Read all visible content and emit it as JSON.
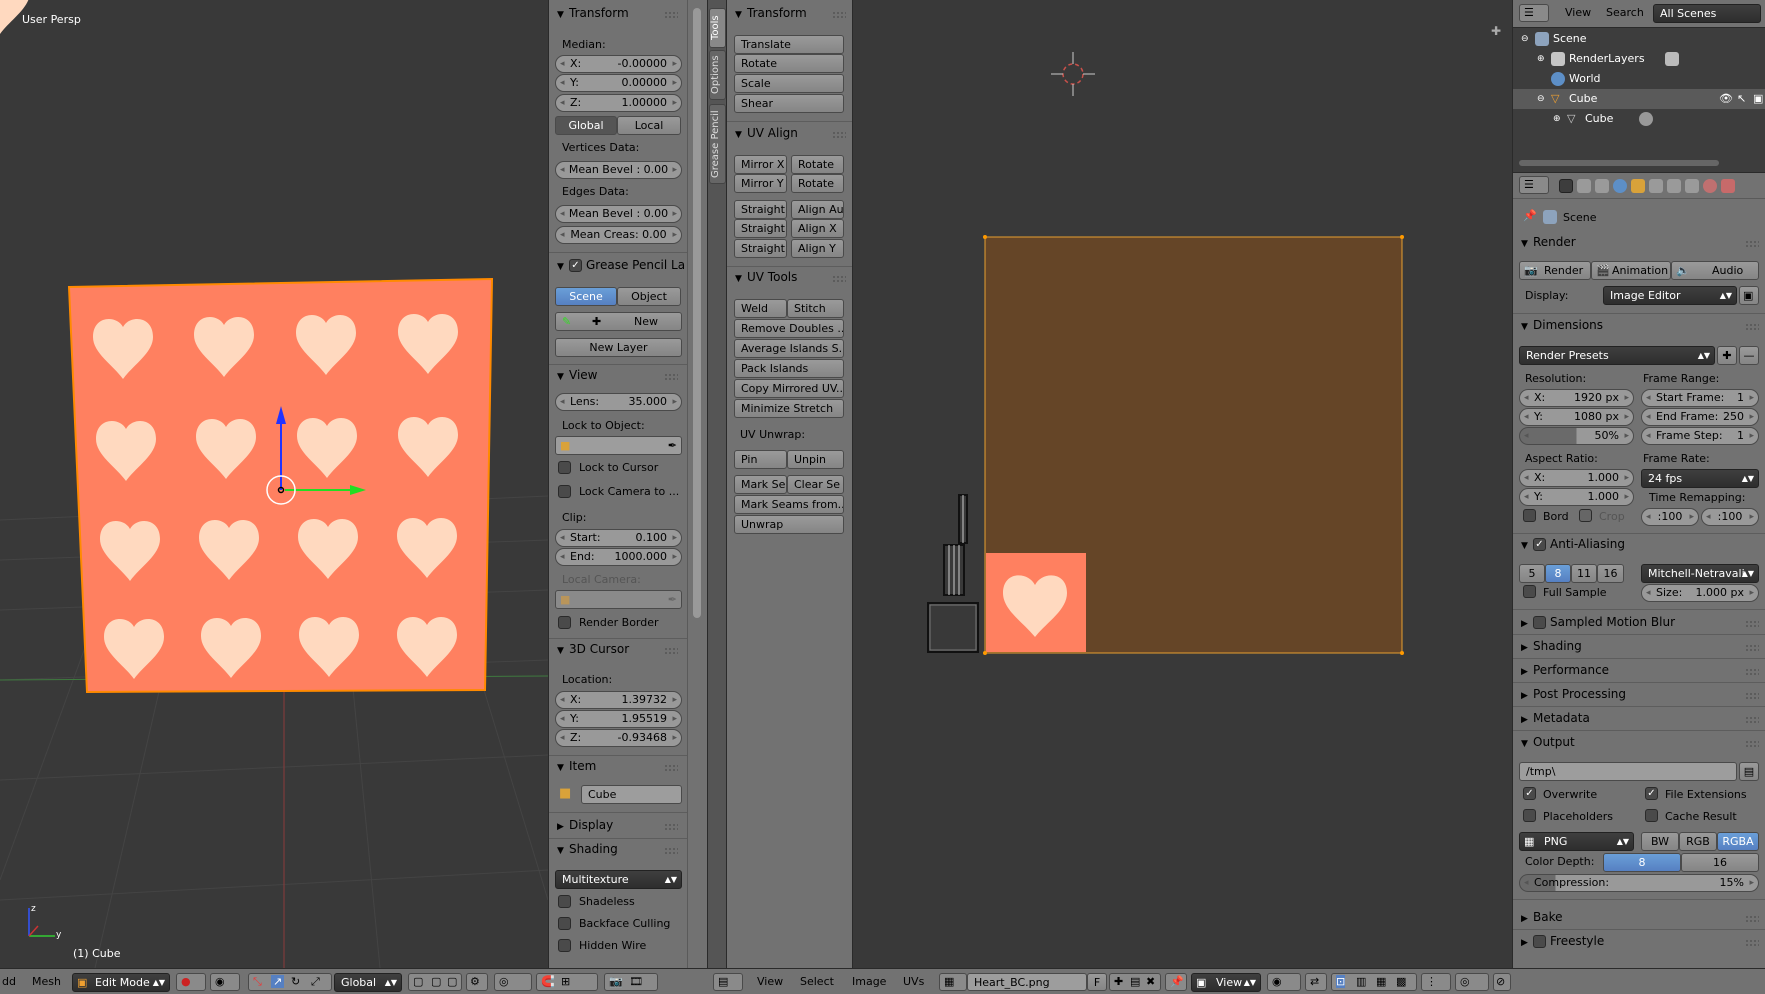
{
  "viewport3d": {
    "view_label": "User Persp",
    "object_label": "(1) Cube",
    "axis_z": "z",
    "axis_y": "y"
  },
  "npanel": {
    "transform_title": "Transform",
    "median_label": "Median:",
    "x_label": "X:",
    "x_value": "-0.00000",
    "y_label": "Y:",
    "y_value": "0.00000",
    "z_label": "Z:",
    "z_value": "1.00000",
    "global_label": "Global",
    "local_label": "Local",
    "vertices_data_label": "Vertices Data:",
    "vert_mean_bevel": "Mean Bevel : 0.00",
    "edges_data_label": "Edges Data:",
    "edge_mean_bevel": "Mean Bevel : 0.00",
    "edge_mean_crease": "Mean Creas:  0.00",
    "grease_title": "Grease Pencil La",
    "scene_label": "Scene",
    "object_label": "Object",
    "new_label": "New",
    "new_layer_label": "New Layer",
    "view_title": "View",
    "lens_label": "Lens:",
    "lens_value": "35.000",
    "lock_to_object_label": "Lock to Object:",
    "lock_to_cursor_label": "Lock to Cursor",
    "lock_camera_label": "Lock Camera to ...",
    "clip_label": "Clip:",
    "clip_start_label": "Start:",
    "clip_start_value": "0.100",
    "clip_end_label": "End:",
    "clip_end_value": "1000.000",
    "local_camera_label": "Local Camera:",
    "render_border_label": "Render Border",
    "cursor_title": "3D Cursor",
    "location_label": "Location:",
    "cx_label": "X:",
    "cx_value": "1.39732",
    "cy_label": "Y:",
    "cy_value": "1.95519",
    "cz_label": "Z:",
    "cz_value": "-0.93468",
    "item_title": "Item",
    "item_name": "Cube",
    "display_title": "Display",
    "shading_title": "Shading",
    "shading_mode": "Multitexture",
    "shadeless_label": "Shadeless",
    "backface_label": "Backface Culling",
    "hidden_wire_label": "Hidden Wire"
  },
  "tool_tabs": [
    "Tools",
    "Options",
    "Grease Pencil"
  ],
  "uvtools": {
    "transform_title": "Transform",
    "translate": "Translate",
    "rotate": "Rotate",
    "scale": "Scale",
    "shear": "Shear",
    "uv_align_title": "UV Align",
    "mirror_x": "Mirror X",
    "rotate2": "Rotate",
    "mirror_y": "Mirror Y",
    "rotate3": "Rotate",
    "straight1": "Straight",
    "align_auto": "Align Au",
    "straight2": "Straight",
    "align_x": "Align X",
    "straight3": "Straight",
    "align_y": "Align Y",
    "uv_tools_title": "UV Tools",
    "weld": "Weld",
    "stitch": "Stitch",
    "remove_doubles": "Remove Doubles ...",
    "average_islands": "Average Islands S...",
    "pack_islands": "Pack Islands",
    "copy_mirrored": "Copy Mirrored UV...",
    "minimize_stretch": "Minimize Stretch",
    "uv_unwrap_label": "UV Unwrap:",
    "pin": "Pin",
    "unpin": "Unpin",
    "mark_seam": "Mark Se",
    "clear_seam": "Clear Se",
    "mark_seams_from": "Mark Seams from...",
    "unwrap": "Unwrap"
  },
  "outliner": {
    "view_menu": "View",
    "search_menu": "Search",
    "scenes_select": "All Scenes",
    "rows": [
      "Scene",
      "RenderLayers",
      "World",
      "Cube",
      "Cube"
    ]
  },
  "properties": {
    "scene_crumb": "Scene",
    "render_title": "Render",
    "render_btn": "Render",
    "animation_btn": "Animation",
    "audio_btn": "Audio",
    "display_label": "Display:",
    "display_value": "Image Editor",
    "dimensions_title": "Dimensions",
    "render_presets": "Render Presets",
    "resolution_label": "Resolution:",
    "res_x_label": "X:",
    "res_x": "1920 px",
    "res_y_label": "Y:",
    "res_y": "1080 px",
    "res_pct": "50%",
    "frame_range_label": "Frame Range:",
    "start_frame_label": "Start Frame:",
    "start_frame": "1",
    "end_frame_label": "End Frame:",
    "end_frame": "250",
    "frame_step_label": "Frame Step:",
    "frame_step": "1",
    "aspect_label": "Aspect Ratio:",
    "asp_x_label": "X:",
    "asp_x": "1.000",
    "asp_y_label": "Y:",
    "asp_y": "1.000",
    "frame_rate_label": "Frame Rate:",
    "frame_rate": "24 fps",
    "time_remap_label": "Time Remapping:",
    "remap_old": ":100",
    "remap_new": ":100",
    "bord_label": "Bord",
    "crop_label": "Crop",
    "aa_title": "Anti-Aliasing",
    "aa_samples": [
      "5",
      "8",
      "11",
      "16"
    ],
    "aa_filter": "Mitchell-Netravali",
    "full_sample_label": "Full Sample",
    "size_label": "Size:",
    "size_value": "1.000 px",
    "motion_blur_title": "Sampled Motion Blur",
    "shading_title": "Shading",
    "performance_title": "Performance",
    "post_processing_title": "Post Processing",
    "metadata_title": "Metadata",
    "output_title": "Output",
    "output_path": "/tmp\\",
    "overwrite_label": "Overwrite",
    "file_ext_label": "File Extensions",
    "placeholders_label": "Placeholders",
    "cache_result_label": "Cache Result",
    "format": "PNG",
    "bw": "BW",
    "rgb": "RGB",
    "rgba": "RGBA",
    "color_depth_label": "Color Depth:",
    "depth_8": "8",
    "depth_16": "16",
    "compression_label": "Compression:",
    "compression_value": "15%",
    "bake_title": "Bake",
    "freestyle_title": "Freestyle"
  },
  "bottom_left": {
    "menu_add": "dd",
    "menu_mesh": "Mesh",
    "mode": "Edit Mode",
    "orientation": "Global"
  },
  "bottom_uv": {
    "view": "View",
    "select": "Select",
    "image": "Image",
    "uvs": "UVs",
    "image_name": "Heart_BC.png",
    "f_label": "F",
    "view_select": "View"
  },
  "colors": {
    "cube_face": "#ff8060",
    "heart": "#ffd9bf",
    "uv_bg": "#654527",
    "accent": "#5680c2"
  }
}
